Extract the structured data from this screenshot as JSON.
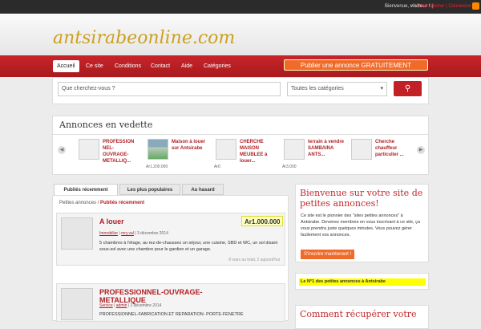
{
  "topbar": {
    "welcome": "Bienvenue,",
    "user": "visiteur !",
    "register": "S'enregistrer",
    "login": "Connexion"
  },
  "header": {
    "logo": "antsirabeonline.com"
  },
  "nav": {
    "items": [
      "Accueil",
      "Ce site",
      "Conditions",
      "Contact",
      "Aide",
      "Catégories"
    ],
    "publish": "Publier une annonce GRATUITEMENT"
  },
  "search": {
    "placeholder": "Que cherchez-vous ?",
    "category": "Toutes les catégories"
  },
  "featured": {
    "title": "Annonces en vedette",
    "items": [
      {
        "title": "PROFESSION NEL-OUVRAGE-METALLIQ...",
        "price": ""
      },
      {
        "title": "Maison à louer sur Antsirabe",
        "price": "Ar1.200.000"
      },
      {
        "title": "CHERCHE MAISON MEUBLEE à louer...",
        "price": "Ar0"
      },
      {
        "title": "terrain à vendre SAMBAINA ANTS...",
        "price": "Ar3.000"
      },
      {
        "title": "Cherche chauffeur particulier ...",
        "price": ""
      }
    ]
  },
  "tabs": [
    "Publiés récemment",
    "Les plus populaires",
    "Au hasard"
  ],
  "breadcrumb": {
    "home": "Petites annonces",
    "current": "Publiés récemment"
  },
  "listings": [
    {
      "title": "A louer",
      "price": "Ar1.000.000",
      "category": "Immobilier",
      "author": "mry.val",
      "date": "3 décembre 2014",
      "desc": "5 chambres à l'étage, au rez-de-chaussez un séjour, une cuisine, SBD et WC, un sol disant sous-sol avec une chambre pour le gardien et un garage.",
      "views": "8 vues au total, 2 aujourd'hui"
    },
    {
      "title": "PROFESSIONNEL-OUVRAGE-METALLIQUE",
      "price": "",
      "category": "Service",
      "author": "admin",
      "date": "2 décembre 2014",
      "desc": "PROFESSIONNEL-FABRICATION ET REPARATION- PORTE-FENETRE",
      "views": ""
    }
  ],
  "sidebar": {
    "welcome_title": "Bienvenue sur votre site de petites annonces!",
    "welcome_text": "Ce site est le pionnier des \"sites petites annonces\" à Antsirabe. Devenez membres en vous inscrivant à ce site, ça vous prendra juste quelques minutes. Vous pouvez gérer facilement vos annonces.",
    "signup": "S'inscrire maintenant !",
    "highlight": "Le N°1 des petites annonces à Antsirabe",
    "recover_title": "Comment récupérer votre"
  }
}
